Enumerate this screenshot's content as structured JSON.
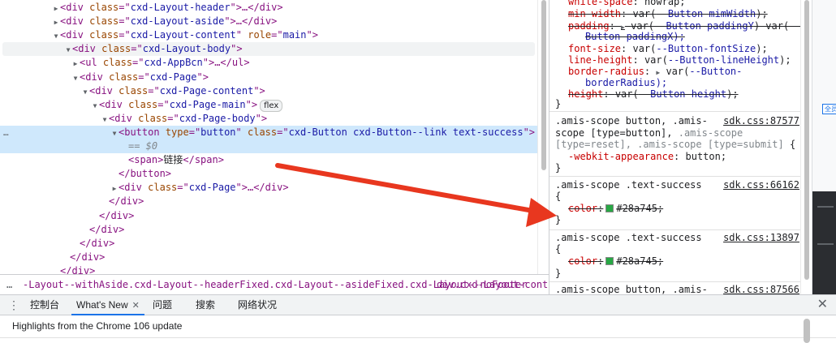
{
  "elements": {
    "lines": [
      {
        "indent": 5,
        "tw": "▶",
        "tag": "div",
        "attrs": [
          {
            "n": "class",
            "v": "cxd-Layout-header"
          }
        ],
        "tail": ">…</div>"
      },
      {
        "indent": 5,
        "tw": "▶",
        "tag": "div",
        "attrs": [
          {
            "n": "class",
            "v": "cxd-Layout-aside"
          }
        ],
        "tail": ">…</div>"
      },
      {
        "indent": 5,
        "tw": "▼",
        "tag": "div",
        "attrs": [
          {
            "n": "class",
            "v": "cxd-Layout-content"
          },
          {
            "n": "role",
            "v": "main"
          }
        ],
        "tail": ">"
      },
      {
        "indent": 6,
        "tw": "▼",
        "tag": "div",
        "attrs": [
          {
            "n": "class",
            "v": "cxd-Layout-body"
          }
        ],
        "tail": ">"
      },
      {
        "indent": 7,
        "tw": "▶",
        "tag": "ul",
        "attrs": [
          {
            "n": "class",
            "v": "cxd-AppBcn"
          }
        ],
        "tail": ">…</ul>"
      },
      {
        "indent": 7,
        "tw": "▼",
        "tag": "div",
        "attrs": [
          {
            "n": "class",
            "v": "cxd-Page"
          }
        ],
        "tail": ">"
      },
      {
        "indent": 8,
        "tw": "▼",
        "tag": "div",
        "attrs": [
          {
            "n": "class",
            "v": "cxd-Page-content"
          }
        ],
        "tail": ">"
      },
      {
        "indent": 9,
        "tw": "▼",
        "tag": "div",
        "attrs": [
          {
            "n": "class",
            "v": "cxd-Page-main"
          }
        ],
        "tail": ">",
        "badge": "flex"
      },
      {
        "indent": 10,
        "tw": "▼",
        "tag": "div",
        "attrs": [
          {
            "n": "class",
            "v": "cxd-Page-body"
          }
        ],
        "tail": ">"
      },
      {
        "indent": 11,
        "tw": "▼",
        "tag": "button",
        "attrs": [
          {
            "n": "type",
            "v": "button"
          },
          {
            "n": "class",
            "v": "cxd-Button cxd-Button--link text-success"
          }
        ],
        "tail": ">"
      },
      {
        "indent": 12,
        "tw": "",
        "raw": "== $0"
      },
      {
        "indent": 12,
        "tw": "",
        "tag": "span",
        "attrs": [],
        "tail": ">",
        "text": "链接",
        "close": "</span>"
      },
      {
        "indent": 11,
        "tw": "",
        "closeonly": "</button>"
      },
      {
        "indent": 11,
        "tw": "▶",
        "tag": "div",
        "attrs": [
          {
            "n": "class",
            "v": "cxd-Page"
          }
        ],
        "tail": ">…</div>"
      },
      {
        "indent": 10,
        "tw": "",
        "closeonly": "</div>"
      },
      {
        "indent": 9,
        "tw": "",
        "closeonly": "</div>"
      },
      {
        "indent": 8,
        "tw": "",
        "closeonly": "</div>"
      },
      {
        "indent": 7,
        "tw": "",
        "closeonly": "</div>"
      },
      {
        "indent": 6,
        "tw": "",
        "closeonly": "</div>"
      },
      {
        "indent": 5,
        "tw": "",
        "closeonly": "</div>"
      }
    ],
    "row_dots": "…"
  },
  "breadcrumb": {
    "dots": "…",
    "item1": "-Layout--withAside.cxd-Layout--headerFixed.cxd-Layout--asideFixed.cxd-Layout--noFooter",
    "item2": "div.cxd-Layout-conte"
  },
  "styles": {
    "rule1": {
      "l1": {
        "p": "white-space",
        "v": "nowrap;"
      },
      "l2": {
        "p": "min-width",
        "v": "var(",
        "var": "--Button-mimWidth",
        "end": ");"
      },
      "l3": {
        "p": "padding",
        "v": "var(",
        "var": "--Button-paddingY",
        "end": ") var(--"
      },
      "l3b": "Button-paddingX);",
      "l4": {
        "p": "font-size",
        "v": "var(",
        "var": "--Button-fontSize",
        "end": ");"
      },
      "l5": {
        "p": "line-height",
        "v": "var(",
        "var": "--Button-lineHeight",
        "end": ");"
      },
      "l6": {
        "p": "border-radius",
        "v": "var(",
        "var": "--Button-",
        "end": ""
      },
      "l6b": "borderRadius);",
      "l7": {
        "p": "height",
        "v": "var(",
        "var": "--Button-height",
        "end": ");"
      },
      "close": "}"
    },
    "rule2": {
      "sel1": ".amis-scope button, .amis-",
      "sel2": "scope [type=button],",
      "sel2b": ".amis-scope",
      "sel3": "[type=reset], .amis-scope [type=submit]",
      "open": "{",
      "prop": "-webkit-appearance",
      "val": "button;",
      "source": "sdk.css:87577",
      "close": "}"
    },
    "rule3": {
      "sel": ".amis-scope .text-success",
      "open": "{",
      "prop": "color",
      "val": "#28a745;",
      "swatch": "#28a745",
      "source": "sdk.css:66162",
      "close": "}"
    },
    "rule4": {
      "sel": ".amis-scope .text-success",
      "open": "{",
      "prop": "color",
      "val": "#28a745;",
      "swatch": "#28a745",
      "source": "sdk.css:13897",
      "close": "}"
    },
    "rule5": {
      "sel": ".amis-scope button, .amis-",
      "source": "sdk.css:87566"
    }
  },
  "edge": {
    "tag": "全员"
  },
  "drawer": {
    "menu_icon": "kebab-menu-icon",
    "tabs": [
      {
        "label": "控制台"
      },
      {
        "label": "What's New",
        "active": true,
        "closable": "✕"
      },
      {
        "label": "问题"
      },
      {
        "label": "搜索"
      },
      {
        "label": "网络状况"
      }
    ],
    "close": "✕",
    "highlight": "Highlights from the Chrome 106 update"
  },
  "colors": {
    "selected_row": "#cfe8fc",
    "tag": "#881280",
    "attr_name": "#994500",
    "attr_value": "#1a1aa6",
    "arrow": "#e8371f",
    "active_tab": "#1a73e8"
  }
}
